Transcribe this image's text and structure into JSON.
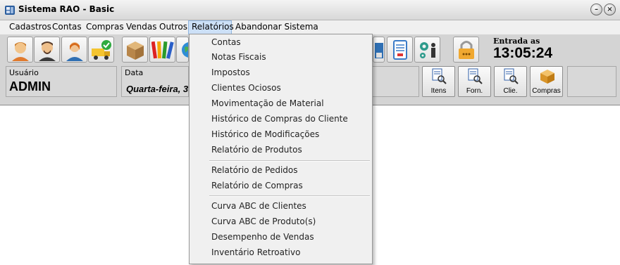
{
  "window": {
    "title": "Sistema RAO - Basic"
  },
  "menubar": {
    "items": [
      {
        "label": "Cadastros"
      },
      {
        "label": "Contas"
      },
      {
        "label": "Compras"
      },
      {
        "label": "Vendas"
      },
      {
        "label": "Outros"
      },
      {
        "label": "Relatórios"
      },
      {
        "label": "Abandonar Sistema"
      }
    ],
    "active": "Relatórios"
  },
  "clock": {
    "label": "Entrada as",
    "time": "13:05:24"
  },
  "info": {
    "user_label": "Usuário",
    "user_value": "ADMIN",
    "date_label": "Data",
    "date_value": "Quarta-feira, 3"
  },
  "quick_buttons": [
    {
      "label": "Itens"
    },
    {
      "label": "Forn."
    },
    {
      "label": "Clie."
    },
    {
      "label": "Compras"
    }
  ],
  "dropdown": {
    "items": [
      {
        "label": "Contas"
      },
      {
        "label": "Notas Fiscais"
      },
      {
        "label": "Impostos"
      },
      {
        "label": "Clientes Ociosos"
      },
      {
        "label": "Movimentação de Material"
      },
      {
        "label": "Histórico de Compras do Cliente"
      },
      {
        "label": "Histórico de Modificações"
      },
      {
        "label": "Relatório de Produtos"
      },
      {
        "label": "Relatório de Pedidos"
      },
      {
        "label": "Relatório de Compras"
      },
      {
        "label": "Curva ABC de Clientes"
      },
      {
        "label": "Curva ABC de Produto(s)"
      },
      {
        "label": "Desempenho de Vendas"
      },
      {
        "label": "Inventário Retroativo"
      }
    ]
  },
  "colors": {
    "menu_highlight": "#cce0f7",
    "toolbar_bg": "#d4d4d4",
    "window_bg": "#ffffff"
  },
  "icons": [
    "app-icon",
    "minimize-icon",
    "close-icon",
    "person-icon",
    "box-icon",
    "color-swatch-icon",
    "document-icon",
    "gear-person-icon",
    "lock-icon",
    "magnifier-document-icon"
  ]
}
